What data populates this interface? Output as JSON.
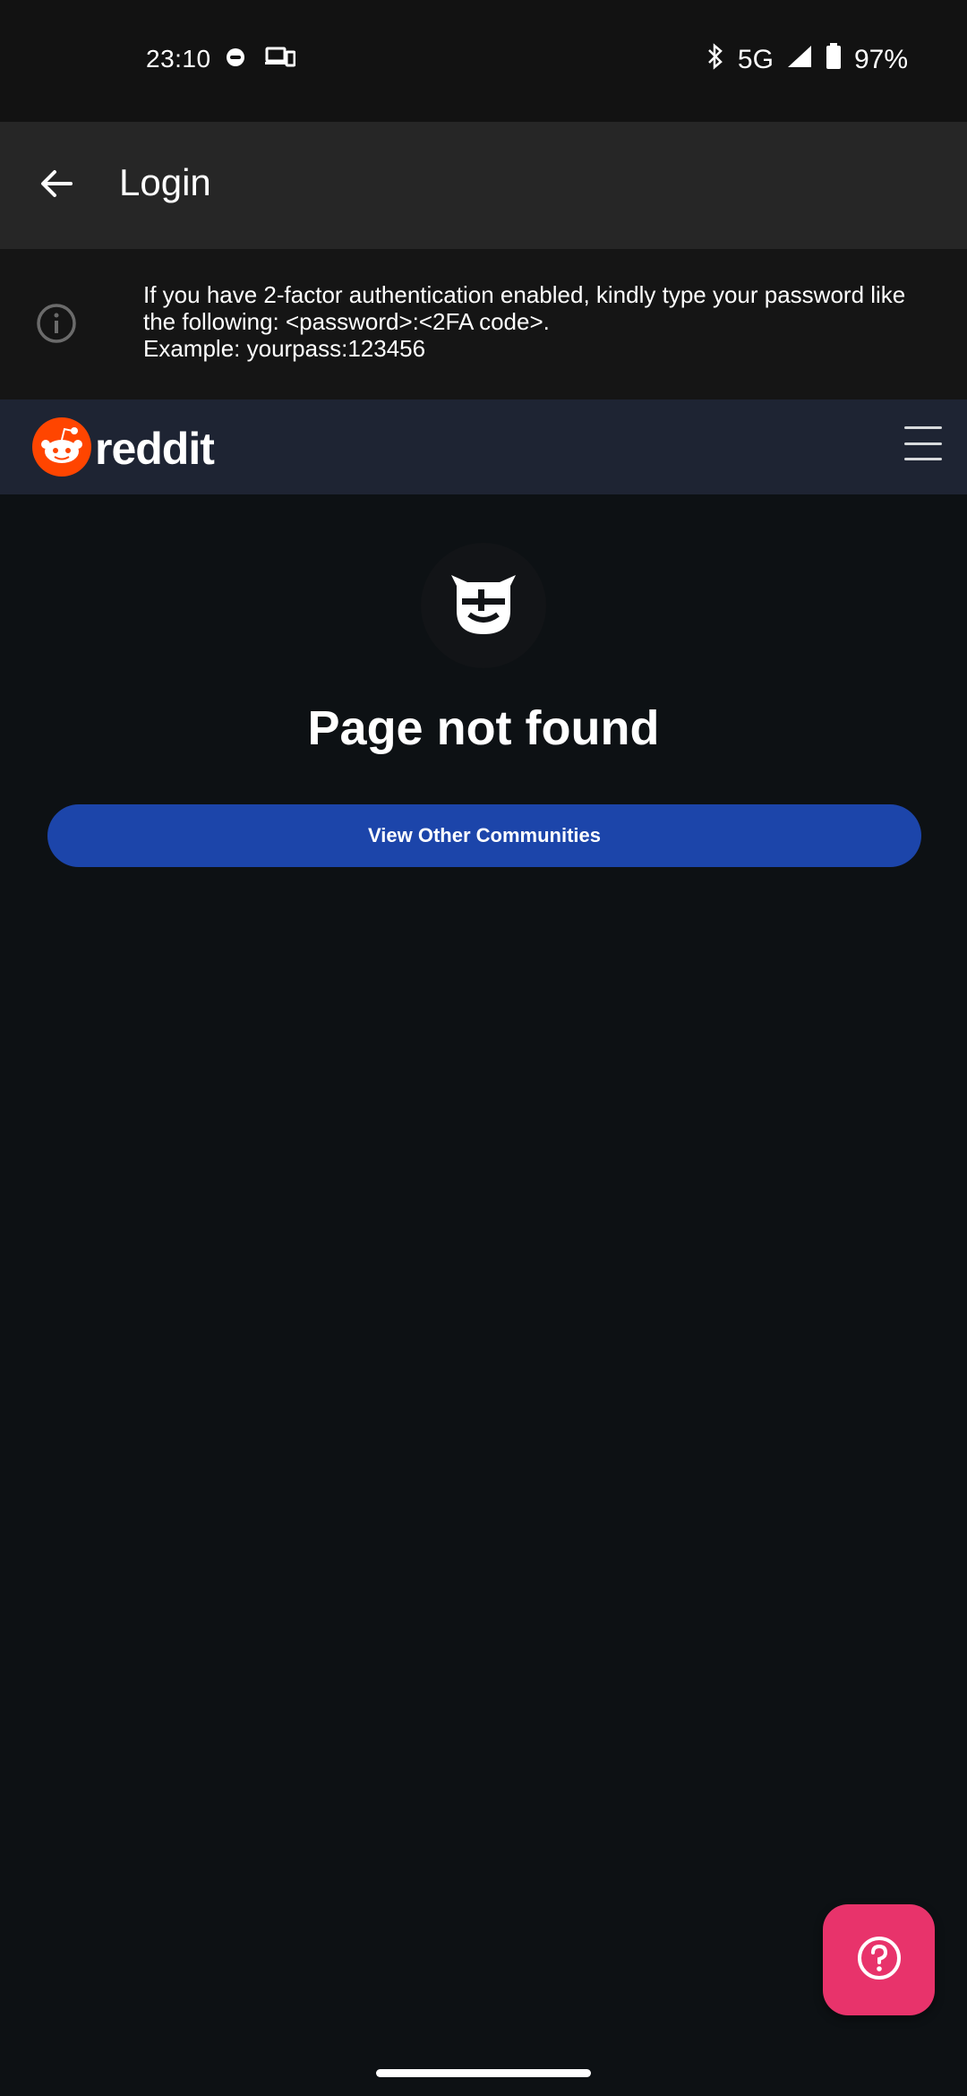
{
  "status_bar": {
    "time": "23:10",
    "network": "5G",
    "battery": "97%",
    "icons": [
      "circle-app-icon",
      "devices-icon",
      "bluetooth-icon",
      "signal-icon",
      "battery-icon"
    ]
  },
  "app_bar": {
    "title": "Login",
    "back_icon": "arrow-left-icon"
  },
  "info_banner": {
    "icon": "info-icon",
    "lines": [
      "If you have 2-factor authentication enabled, kindly type your password like",
      "the following: <password>:<2FA code>.",
      "Example: yourpass:123456"
    ]
  },
  "reddit_header": {
    "wordmark": "reddit",
    "menu_icon": "hamburger-menu-icon"
  },
  "content": {
    "title": "Page not found",
    "button_label": "View Other Communities"
  },
  "fab": {
    "icon": "help-icon"
  },
  "colors": {
    "background": "#0d1114",
    "app_bar": "#262626",
    "reddit_header": "#1e2433",
    "button": "#1c45aa",
    "fab": "#e8336b",
    "reddit_orange": "#ff4500"
  }
}
